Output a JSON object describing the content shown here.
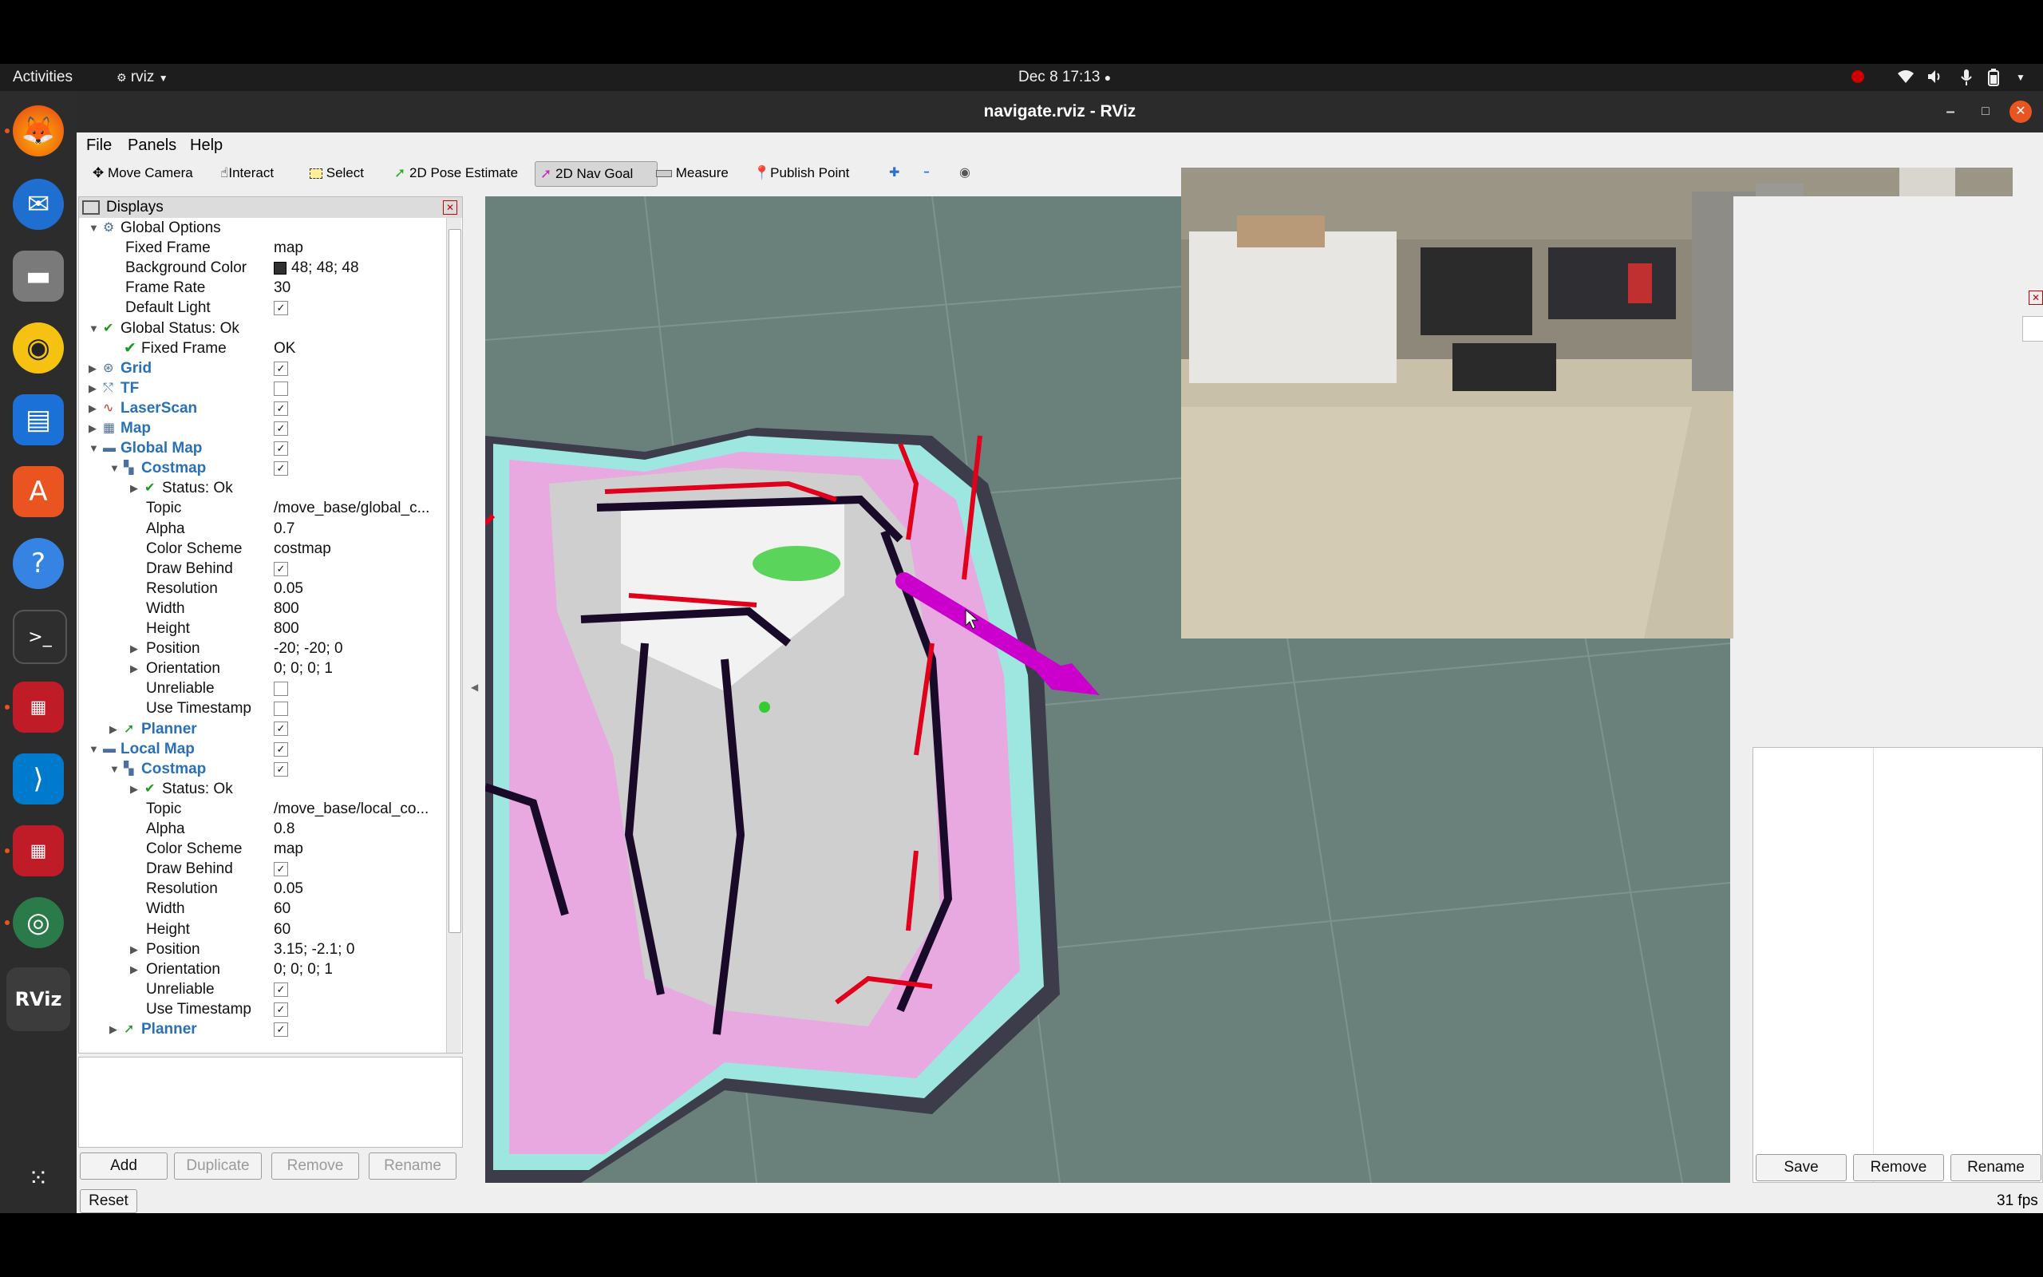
{
  "topbar": {
    "activities": "Activities",
    "app_menu": "rviz",
    "clock": "Dec 8  17:13",
    "record_dot": "●"
  },
  "window": {
    "title": "navigate.rviz - RViz",
    "minimize": "–",
    "maximize": "□",
    "close": "✕"
  },
  "menubar": {
    "file": "File",
    "panels": "Panels",
    "help": "Help"
  },
  "toolbar": {
    "move_camera": "Move Camera",
    "interact": "Interact",
    "select": "Select",
    "pose_estimate": "2D Pose Estimate",
    "nav_goal": "2D Nav Goal",
    "measure": "Measure",
    "publish_point": "Publish Point",
    "zoom_in": "✚",
    "zoom_out": "━",
    "view": "◉"
  },
  "displays": {
    "header": "Displays",
    "rows": [
      {
        "label": "Global Options",
        "value": "",
        "depth": 0,
        "arrow": "▼",
        "check": false
      },
      {
        "label": "Fixed Frame",
        "value": "map",
        "depth": 1,
        "arrow": "",
        "check": false
      },
      {
        "label": "Background Color",
        "value": "48; 48; 48",
        "depth": 1,
        "arrow": "",
        "check": false
      },
      {
        "label": "Frame Rate",
        "value": "30",
        "depth": 1,
        "arrow": "",
        "check": false
      },
      {
        "label": "Default Light",
        "value": "",
        "depth": 1,
        "arrow": "",
        "check": true
      },
      {
        "label": "Global Status: Ok",
        "value": "",
        "depth": 0,
        "arrow": "▼",
        "check": false
      },
      {
        "label": "Fixed Frame",
        "value": "OK",
        "depth": 1,
        "arrow": "",
        "check": false
      },
      {
        "label": "Grid",
        "value": "",
        "depth": 0,
        "arrow": "▶",
        "check": true
      },
      {
        "label": "TF",
        "value": "",
        "depth": 0,
        "arrow": "▶",
        "check": false
      },
      {
        "label": "LaserScan",
        "value": "",
        "depth": 0,
        "arrow": "▶",
        "check": true
      },
      {
        "label": "Map",
        "value": "",
        "depth": 0,
        "arrow": "▶",
        "check": true
      },
      {
        "label": "Global Map",
        "value": "",
        "depth": 0,
        "arrow": "▼",
        "check": true
      },
      {
        "label": "Costmap",
        "value": "",
        "depth": 1,
        "arrow": "▼",
        "check": true
      },
      {
        "label": "Status: Ok",
        "value": "",
        "depth": 2,
        "arrow": "▶",
        "check": false
      },
      {
        "label": "Topic",
        "value": "/move_base/global_c...",
        "depth": 2,
        "arrow": "",
        "check": false
      },
      {
        "label": "Alpha",
        "value": "0.7",
        "depth": 2,
        "arrow": "",
        "check": false
      },
      {
        "label": "Color Scheme",
        "value": "costmap",
        "depth": 2,
        "arrow": "",
        "check": false
      },
      {
        "label": "Draw Behind",
        "value": "",
        "depth": 2,
        "arrow": "",
        "check": true
      },
      {
        "label": "Resolution",
        "value": "0.05",
        "depth": 2,
        "arrow": "",
        "check": false
      },
      {
        "label": "Width",
        "value": "800",
        "depth": 2,
        "arrow": "",
        "check": false
      },
      {
        "label": "Height",
        "value": "800",
        "depth": 2,
        "arrow": "",
        "check": false
      },
      {
        "label": "Position",
        "value": "-20; -20; 0",
        "depth": 2,
        "arrow": "▶",
        "check": false
      },
      {
        "label": "Orientation",
        "value": "0; 0; 0; 1",
        "depth": 2,
        "arrow": "▶",
        "check": false
      },
      {
        "label": "Unreliable",
        "value": "",
        "depth": 2,
        "arrow": "",
        "check": false
      },
      {
        "label": "Use Timestamp",
        "value": "",
        "depth": 2,
        "arrow": "",
        "check": false
      },
      {
        "label": "Planner",
        "value": "",
        "depth": 1,
        "arrow": "▶",
        "check": true
      },
      {
        "label": "Local Map",
        "value": "",
        "depth": 0,
        "arrow": "▼",
        "check": true
      },
      {
        "label": "Costmap",
        "value": "",
        "depth": 1,
        "arrow": "▼",
        "check": true
      },
      {
        "label": "Status: Ok",
        "value": "",
        "depth": 2,
        "arrow": "▶",
        "check": false
      },
      {
        "label": "Topic",
        "value": "/move_base/local_co...",
        "depth": 2,
        "arrow": "",
        "check": false
      },
      {
        "label": "Alpha",
        "value": "0.8",
        "depth": 2,
        "arrow": "",
        "check": false
      },
      {
        "label": "Color Scheme",
        "value": "map",
        "depth": 2,
        "arrow": "",
        "check": false
      },
      {
        "label": "Draw Behind",
        "value": "",
        "depth": 2,
        "arrow": "",
        "check": true
      },
      {
        "label": "Resolution",
        "value": "0.05",
        "depth": 2,
        "arrow": "",
        "check": false
      },
      {
        "label": "Width",
        "value": "60",
        "depth": 2,
        "arrow": "",
        "check": false
      },
      {
        "label": "Height",
        "value": "60",
        "depth": 2,
        "arrow": "",
        "check": false
      },
      {
        "label": "Position",
        "value": "3.15; -2.1; 0",
        "depth": 2,
        "arrow": "▶",
        "check": false
      },
      {
        "label": "Orientation",
        "value": "0; 0; 0; 1",
        "depth": 2,
        "arrow": "▶",
        "check": false
      },
      {
        "label": "Unreliable",
        "value": "",
        "depth": 2,
        "arrow": "",
        "check": true
      },
      {
        "label": "Use Timestamp",
        "value": "",
        "depth": 2,
        "arrow": "",
        "check": true
      },
      {
        "label": "Planner",
        "value": "",
        "depth": 1,
        "arrow": "▶",
        "check": true
      }
    ]
  },
  "buttons": {
    "add": "Add",
    "duplicate": "Duplicate",
    "remove": "Remove",
    "rename": "Rename",
    "reset": "Reset",
    "save": "Save",
    "views_remove": "Remove",
    "views_rename": "Rename"
  },
  "status": {
    "fps": "31 fps"
  },
  "colors": {
    "viewport_bg": "#6a817b",
    "nav_arrow": "#cc00cc",
    "laser": "#e0001b",
    "costmap_cyan": "#9ee6e0",
    "costmap_pink": "#e8a8e0"
  }
}
